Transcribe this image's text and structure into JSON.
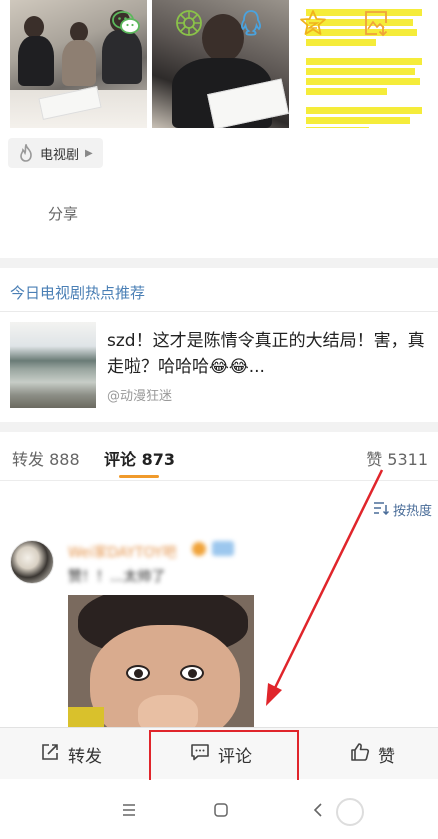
{
  "media": {
    "photo_1": "classroom-photo",
    "photo_2": "student-reading-photo",
    "document": "highlighted-text-image"
  },
  "tag": {
    "label": "电视剧",
    "icon": "fire-icon"
  },
  "share": {
    "label": "分享",
    "targets": [
      "wechat-icon",
      "moments-icon",
      "qq-icon",
      "qzone-icon",
      "save-image-icon"
    ]
  },
  "recommend": {
    "title": "今日电视剧热点推荐",
    "headline": "szd！这才是陈情令真正的大结局！害，真走啦？哈哈哈😂😂...",
    "source": "@动漫狂迷"
  },
  "tabs": {
    "repost": "转发 888",
    "comments": "评论 873",
    "likes": "赞 5311"
  },
  "sort": {
    "label": "按热度",
    "icon": "sort-icon"
  },
  "comment": {
    "username": "Wei家DAYTOY吧",
    "text": "赞！！...太帅了"
  },
  "actions": {
    "repost": "转发",
    "comment": "评论",
    "like": "赞"
  },
  "colors": {
    "link_blue": "#4a7fb5",
    "tab_underline": "#f09a2b",
    "highlight_red": "#e0252b",
    "username_orange": "#e4944c"
  }
}
